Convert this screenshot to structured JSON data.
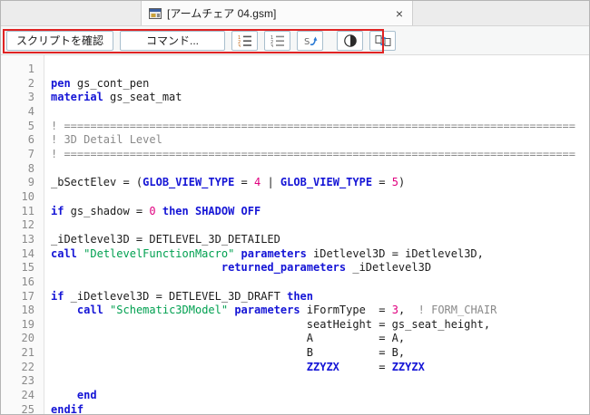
{
  "tab": {
    "title": "[アームチェア 04.gsm]",
    "close_label": "×"
  },
  "toolbar": {
    "check_script": "スクリプトを確認",
    "commands": "コマンド...",
    "icons": [
      "line-numbers-icon",
      "line-numbers-all-icon",
      "jump-to-script-icon",
      "contrast-icon",
      "script-sync-icon"
    ]
  },
  "colors": {
    "keyword": "#1515d6",
    "global": "#1515d6",
    "comment": "#8a8a8a",
    "string": "#00a050",
    "number": "#e0007f",
    "plain": "#1c1c1c",
    "annotation": "#e02323"
  },
  "editor": {
    "lines": [
      {
        "n": 1,
        "tokens": []
      },
      {
        "n": 2,
        "tokens": [
          {
            "t": "pen",
            "c": "kw"
          },
          {
            "t": " gs_cont_pen",
            "c": "id"
          }
        ]
      },
      {
        "n": 3,
        "tokens": [
          {
            "t": "material",
            "c": "kw"
          },
          {
            "t": " gs_seat_mat",
            "c": "id"
          }
        ]
      },
      {
        "n": 4,
        "tokens": []
      },
      {
        "n": 5,
        "tokens": [
          {
            "t": "! ==============================================================================",
            "c": "cm"
          }
        ]
      },
      {
        "n": 6,
        "tokens": [
          {
            "t": "! 3D Detail Level",
            "c": "cm"
          }
        ]
      },
      {
        "n": 7,
        "tokens": [
          {
            "t": "! ==============================================================================",
            "c": "cm"
          }
        ]
      },
      {
        "n": 8,
        "tokens": []
      },
      {
        "n": 9,
        "tokens": [
          {
            "t": "_bSectElev = (",
            "c": "id"
          },
          {
            "t": "GLOB_VIEW_TYPE",
            "c": "glob"
          },
          {
            "t": " = ",
            "c": "id"
          },
          {
            "t": "4",
            "c": "num"
          },
          {
            "t": " | ",
            "c": "id"
          },
          {
            "t": "GLOB_VIEW_TYPE",
            "c": "glob"
          },
          {
            "t": " = ",
            "c": "id"
          },
          {
            "t": "5",
            "c": "num"
          },
          {
            "t": ")",
            "c": "id"
          }
        ]
      },
      {
        "n": 10,
        "tokens": []
      },
      {
        "n": 11,
        "tokens": [
          {
            "t": "if",
            "c": "kw"
          },
          {
            "t": " gs_shadow = ",
            "c": "id"
          },
          {
            "t": "0",
            "c": "num"
          },
          {
            "t": " ",
            "c": "id"
          },
          {
            "t": "then",
            "c": "kw"
          },
          {
            "t": " ",
            "c": "id"
          },
          {
            "t": "SHADOW OFF",
            "c": "kw"
          }
        ]
      },
      {
        "n": 12,
        "tokens": []
      },
      {
        "n": 13,
        "tokens": [
          {
            "t": "_iDetlevel3D = DETLEVEL_3D_DETAILED",
            "c": "id"
          }
        ]
      },
      {
        "n": 14,
        "tokens": [
          {
            "t": "call",
            "c": "kw"
          },
          {
            "t": " ",
            "c": "id"
          },
          {
            "t": "\"DetlevelFunctionMacro\"",
            "c": "str"
          },
          {
            "t": " ",
            "c": "id"
          },
          {
            "t": "parameters",
            "c": "kw"
          },
          {
            "t": " iDetlevel3D = iDetlevel3D,",
            "c": "id"
          }
        ]
      },
      {
        "n": 15,
        "tokens": [
          {
            "t": "                          ",
            "c": "id"
          },
          {
            "t": "returned_parameters",
            "c": "kw"
          },
          {
            "t": " _iDetlevel3D",
            "c": "id"
          }
        ]
      },
      {
        "n": 16,
        "tokens": []
      },
      {
        "n": 17,
        "tokens": [
          {
            "t": "if",
            "c": "kw"
          },
          {
            "t": " _iDetlevel3D = DETLEVEL_3D_DRAFT ",
            "c": "id"
          },
          {
            "t": "then",
            "c": "kw"
          }
        ]
      },
      {
        "n": 18,
        "tokens": [
          {
            "t": "    ",
            "c": "id"
          },
          {
            "t": "call",
            "c": "kw"
          },
          {
            "t": " ",
            "c": "id"
          },
          {
            "t": "\"Schematic3DModel\"",
            "c": "str"
          },
          {
            "t": " ",
            "c": "id"
          },
          {
            "t": "parameters",
            "c": "kw"
          },
          {
            "t": " iFormType  = ",
            "c": "id"
          },
          {
            "t": "3",
            "c": "num"
          },
          {
            "t": ",  ",
            "c": "id"
          },
          {
            "t": "! FORM_CHAIR",
            "c": "cm"
          }
        ]
      },
      {
        "n": 19,
        "tokens": [
          {
            "t": "                                       seatHeight = gs_seat_height,",
            "c": "id"
          }
        ]
      },
      {
        "n": 20,
        "tokens": [
          {
            "t": "                                       A          = A,",
            "c": "id"
          }
        ]
      },
      {
        "n": 21,
        "tokens": [
          {
            "t": "                                       B          = B,",
            "c": "id"
          }
        ]
      },
      {
        "n": 22,
        "tokens": [
          {
            "t": "                                       ",
            "c": "id"
          },
          {
            "t": "ZZYZX",
            "c": "glob"
          },
          {
            "t": "      = ",
            "c": "id"
          },
          {
            "t": "ZZYZX",
            "c": "glob"
          }
        ]
      },
      {
        "n": 23,
        "tokens": []
      },
      {
        "n": 24,
        "tokens": [
          {
            "t": "    ",
            "c": "id"
          },
          {
            "t": "end",
            "c": "kw"
          }
        ]
      },
      {
        "n": 25,
        "tokens": [
          {
            "t": "endif",
            "c": "kw"
          }
        ]
      }
    ]
  }
}
